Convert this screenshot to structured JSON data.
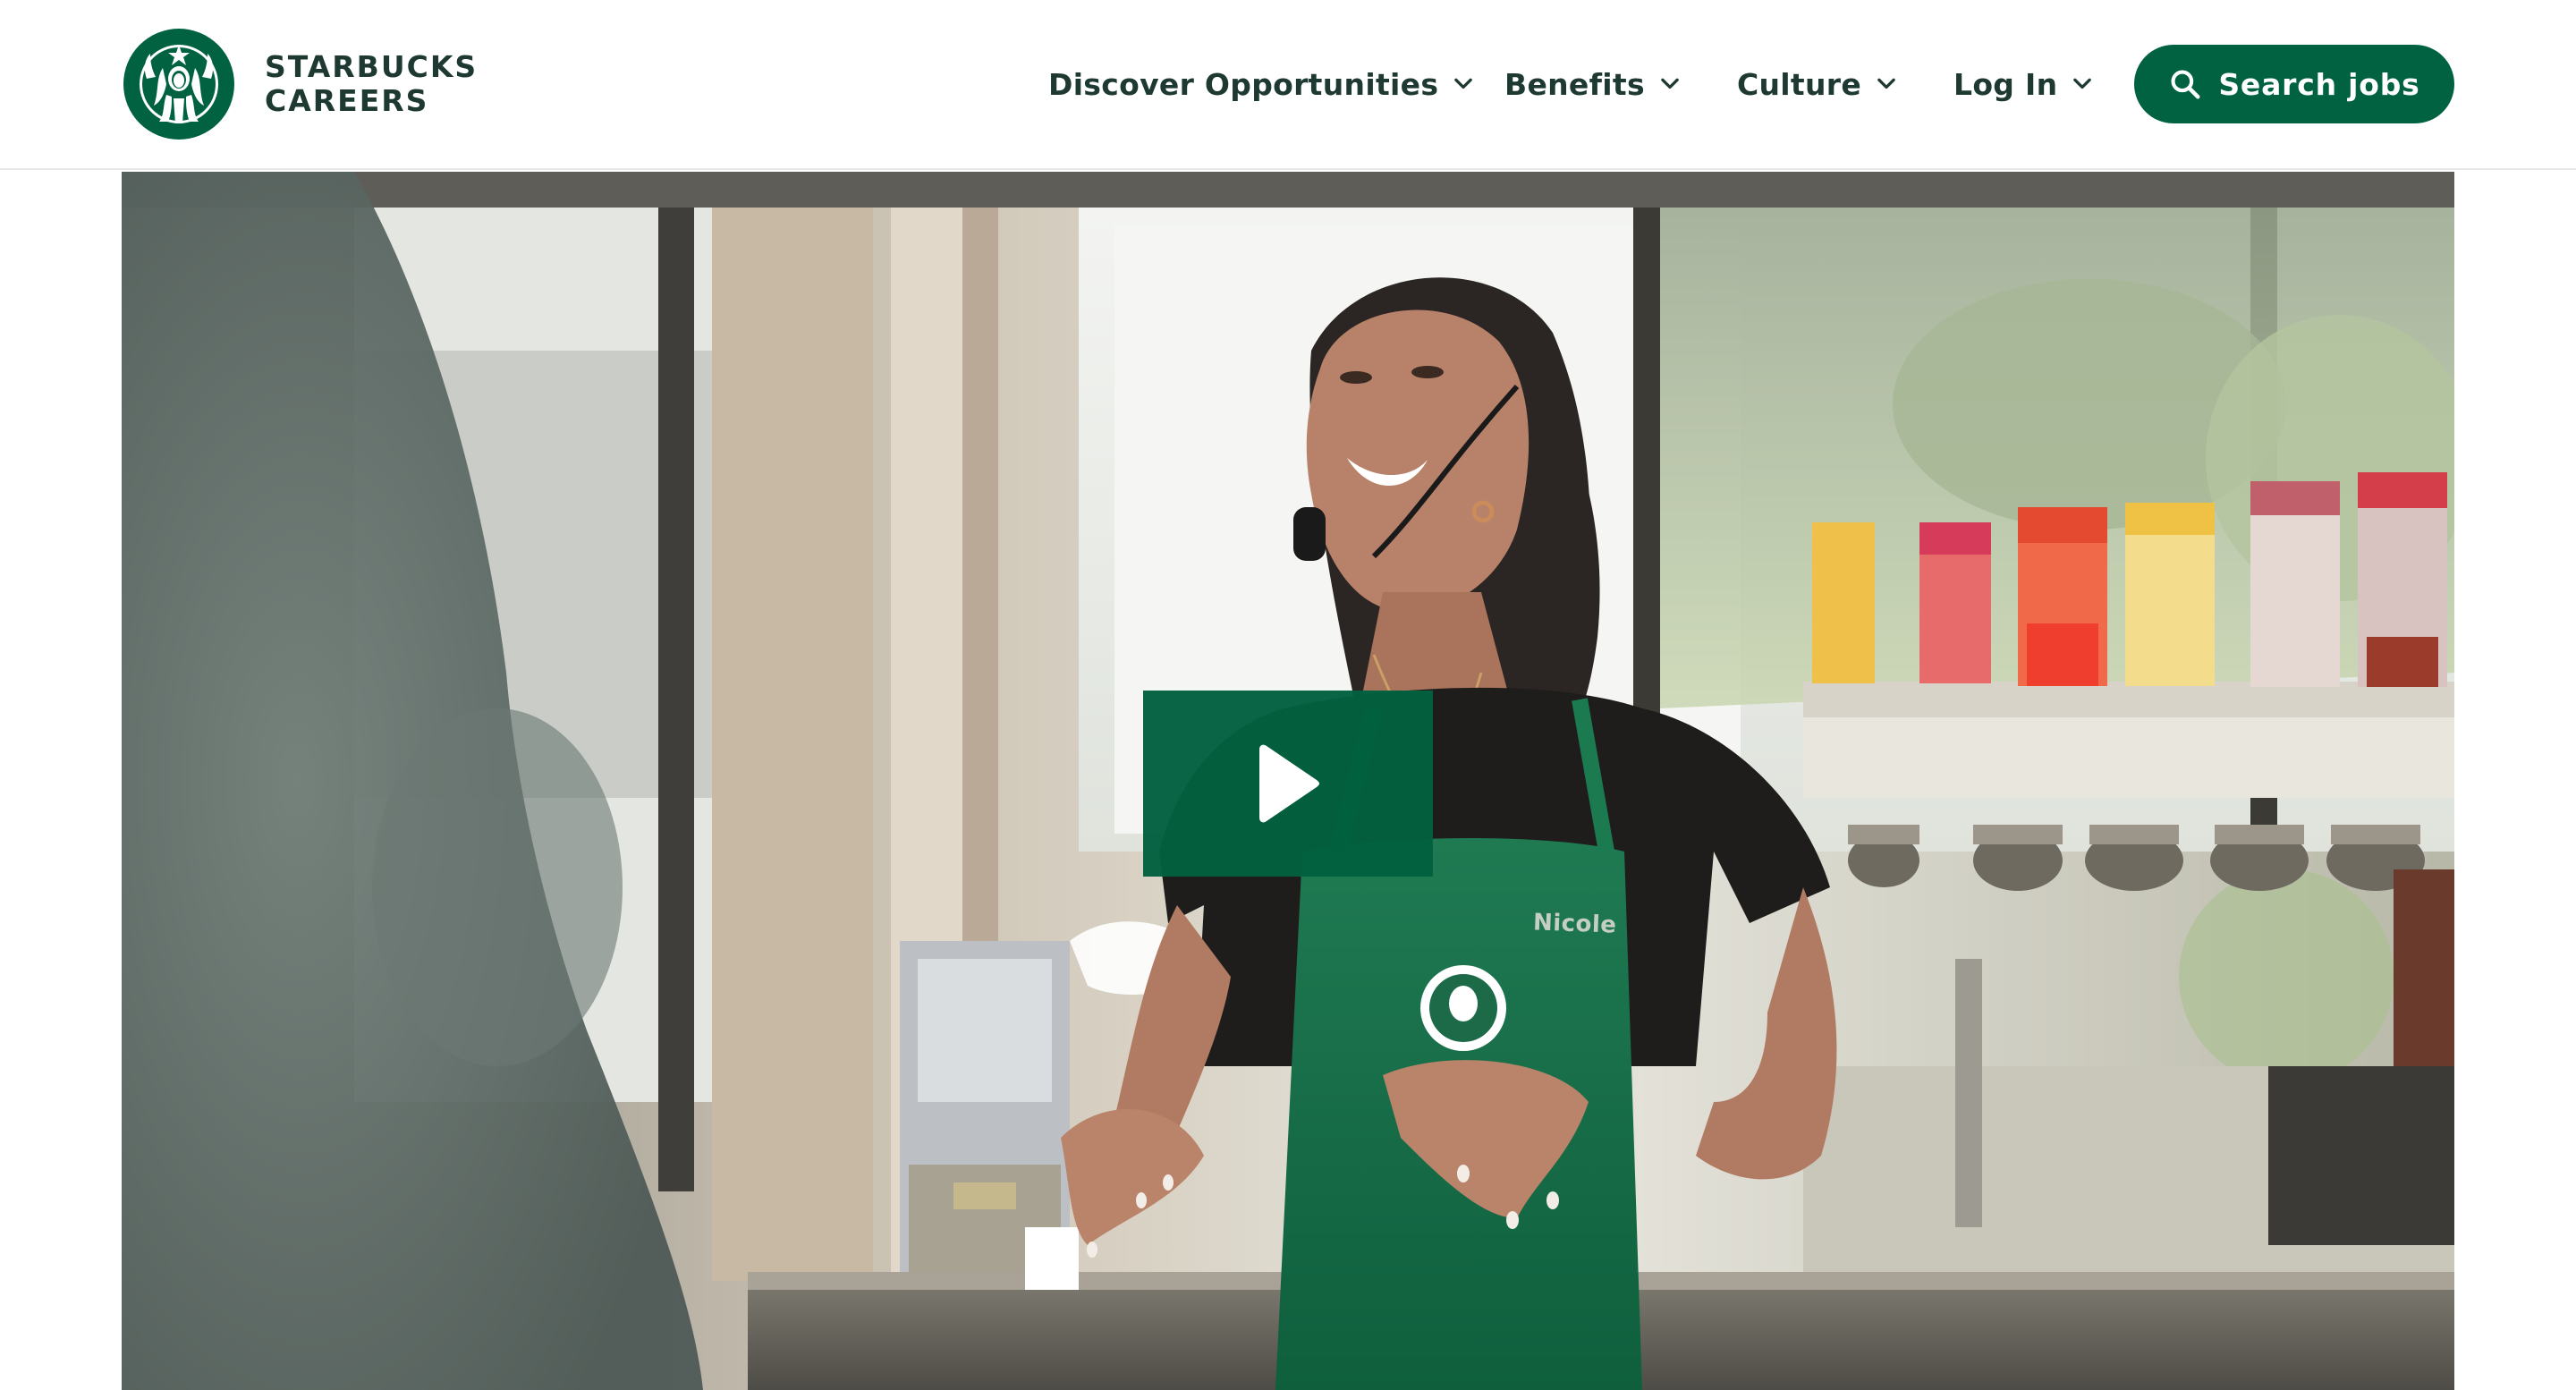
{
  "brand": {
    "line1": "STARBUCKS",
    "line2": "CAREERS",
    "logo_icon": "starbucks-siren-logo",
    "color": "#006241"
  },
  "nav": {
    "items": [
      {
        "label": "Discover Opportunities",
        "icon": "chevron-down-icon"
      },
      {
        "label": "Benefits",
        "icon": "chevron-down-icon"
      },
      {
        "label": "Culture",
        "icon": "chevron-down-icon"
      },
      {
        "label": "Log In",
        "icon": "chevron-down-icon"
      }
    ],
    "search_button": {
      "label": "Search jobs",
      "icon": "search-icon"
    }
  },
  "hero": {
    "video": {
      "play_icon": "play-icon",
      "apron_name": "Nicole"
    }
  },
  "colors": {
    "brand_green": "#006241",
    "text_dark_green": "#1e3932",
    "play_bg": "#01603f"
  }
}
